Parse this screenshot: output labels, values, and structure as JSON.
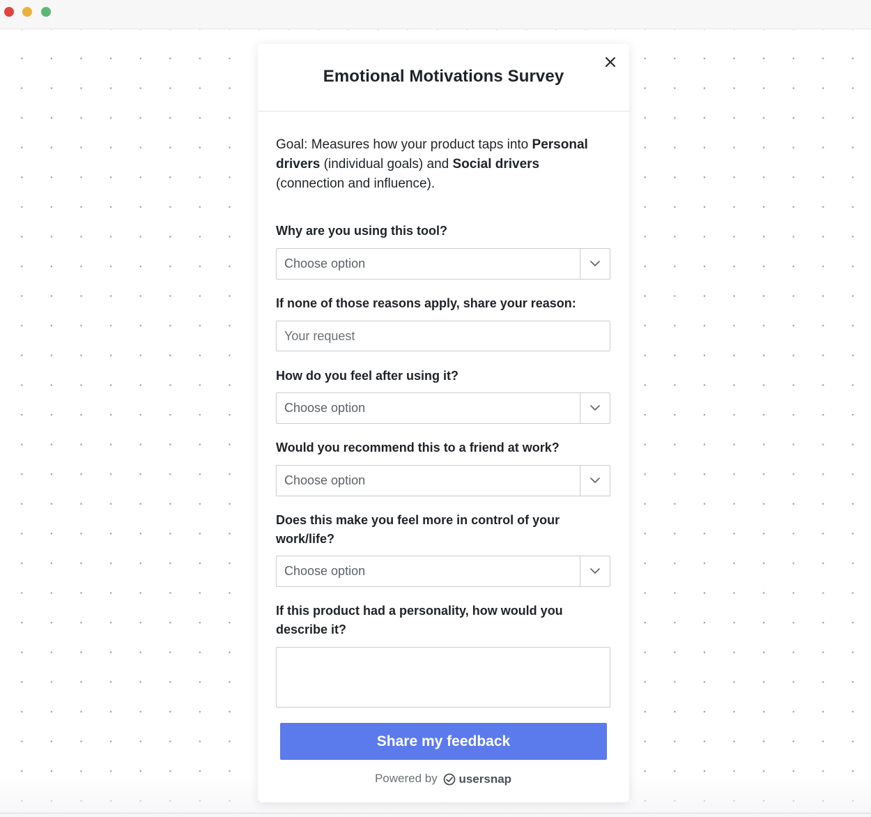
{
  "window": {
    "controls": [
      "close",
      "minimize",
      "maximize"
    ]
  },
  "survey": {
    "title": "Emotional Motivations Survey",
    "goal": {
      "prefix": "Goal: Measures how your product taps into ",
      "personal": "Personal drivers",
      "middle": " (individual goals) and ",
      "social": "Social drivers",
      "suffix": " (connection and influence)."
    },
    "questions": [
      {
        "label": "Why are you using this tool?",
        "type": "select",
        "value": "Choose option"
      },
      {
        "label": "If none of those reasons apply, share your reason:",
        "type": "text",
        "placeholder": "Your request"
      },
      {
        "label": "How do you feel after using it?",
        "type": "select",
        "value": "Choose option"
      },
      {
        "label": "Would you recommend this to a friend at work?",
        "type": "select",
        "value": "Choose option"
      },
      {
        "label": "Does this make you feel more in control of your work/life?",
        "type": "select",
        "value": "Choose option"
      },
      {
        "label": "If this product had a personality, how would you describe it?",
        "type": "textarea",
        "value": ""
      }
    ],
    "submit_label": "Share my feedback",
    "powered_by": "Powered by",
    "brand": "usersnap"
  },
  "colors": {
    "accent": "#5b7bec",
    "close_dot": "#e0443c",
    "minimize_dot": "#e9b23a",
    "maximize_dot": "#5cb874"
  }
}
